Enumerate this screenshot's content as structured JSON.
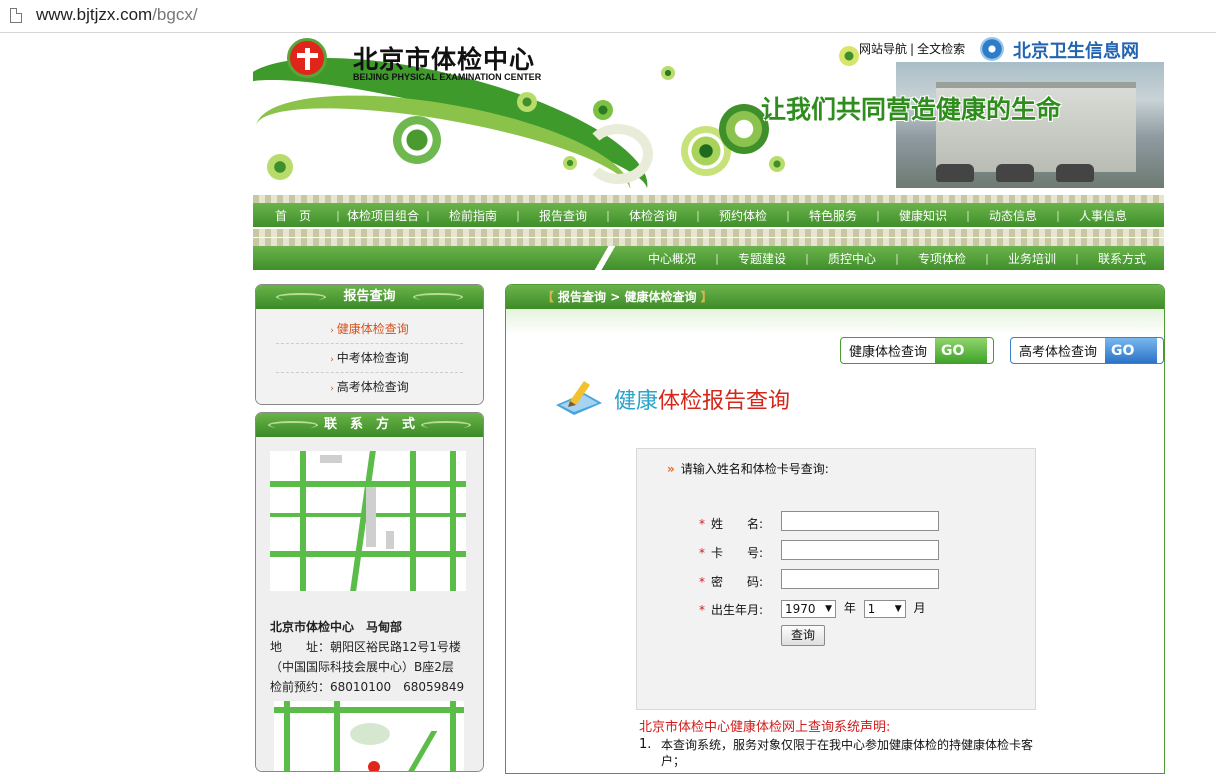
{
  "browser": {
    "url_host": "www.bjtjzx.com",
    "url_path": "/bgcx/"
  },
  "header": {
    "logo_title": "北京市体检中心",
    "logo_subtitle": "BEIJING PHYSICAL EXAMINATION CENTER",
    "top_links": [
      "网站导航",
      "全文检索"
    ],
    "partner_name": "北京卫生信息网",
    "slogan": "让我们共同营造健康的生命"
  },
  "nav_main": [
    "首　页",
    "体检项目组合",
    "检前指南",
    "报告查询",
    "体检咨询",
    "预约体检",
    "特色服务",
    "健康知识",
    "动态信息",
    "人事信息"
  ],
  "nav_sub": [
    "中心概况",
    "专题建设",
    "质控中心",
    "专项体检",
    "业务培训",
    "联系方式"
  ],
  "sidebar": {
    "report_title": "报告查询",
    "report_items": [
      {
        "label": "健康体检查询",
        "active": true
      },
      {
        "label": "中考体检查询",
        "active": false
      },
      {
        "label": "高考体检查询",
        "active": false
      }
    ],
    "contact_title": "联　系　方　式",
    "center_name": "北京市体检中心　马甸部",
    "address_label": "地　　址：",
    "address_line1": "朝阳区裕民路12号1号楼",
    "address_line2": "（中国国际科技会展中心）B座2层",
    "phone_label": "检前预约：",
    "phones": "68010100　68059849"
  },
  "main": {
    "breadcrumb": [
      "报告查询",
      "健康体检查询"
    ],
    "breadcrumb_sep": ">",
    "go_buttons": [
      {
        "label": "健康体检查询",
        "go": "GO"
      },
      {
        "label": "高考体检查询",
        "go": "GO"
      }
    ],
    "report_title_part1": "健康",
    "report_title_part2": "体检报告查询",
    "form": {
      "hint": "请输入姓名和体检卡号查询:",
      "name_label": "姓　　名:",
      "card_label": "卡　　号:",
      "password_label": "密　　码:",
      "birth_label": "出生年月:",
      "year_value": "1970",
      "year_unit": "年",
      "month_value": "1",
      "month_unit": "月",
      "submit_label": "查询"
    },
    "declaration_title": "北京市体检中心健康体检网上查询系统声明:",
    "declaration_items": [
      {
        "num": "1.",
        "text": "本查询系统，服务对象仅限于在我中心参加健康体检的持健康体检卡客户；"
      }
    ]
  },
  "colors": {
    "nav_green": "#3f8f2a",
    "accent_red": "#d01c1c",
    "active_orange": "#d5521d",
    "title_blue": "#2aa3c9"
  }
}
